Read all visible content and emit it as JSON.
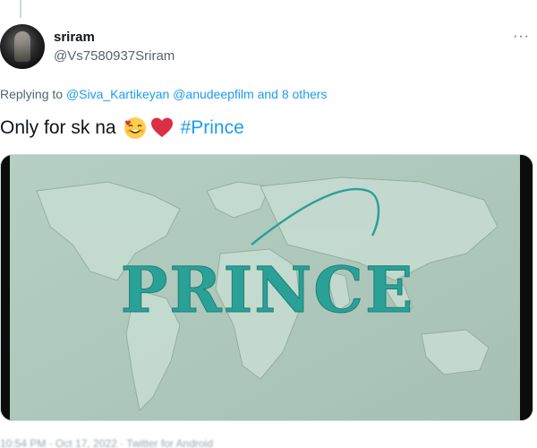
{
  "tweet": {
    "author_name": "sriram",
    "author_handle": "@Vs7580937Sriram",
    "more_label": "···",
    "reply_prefix": "Replying to",
    "reply_mentions": "@Siva_Kartikeyan @anudeepfilm",
    "reply_others": "and 8 others",
    "text": "Only for sk na",
    "emojis": [
      "smiling-face-with-hearts-icon",
      "red-heart-icon"
    ],
    "hashtag": "#Prince"
  },
  "media": {
    "title_text": "PRINCE",
    "title_color": "#2aa197",
    "background_color": "#a8c2b6"
  },
  "footer": {
    "text": "10:54 PM · Oct 17, 2022 · Twitter for Android"
  }
}
